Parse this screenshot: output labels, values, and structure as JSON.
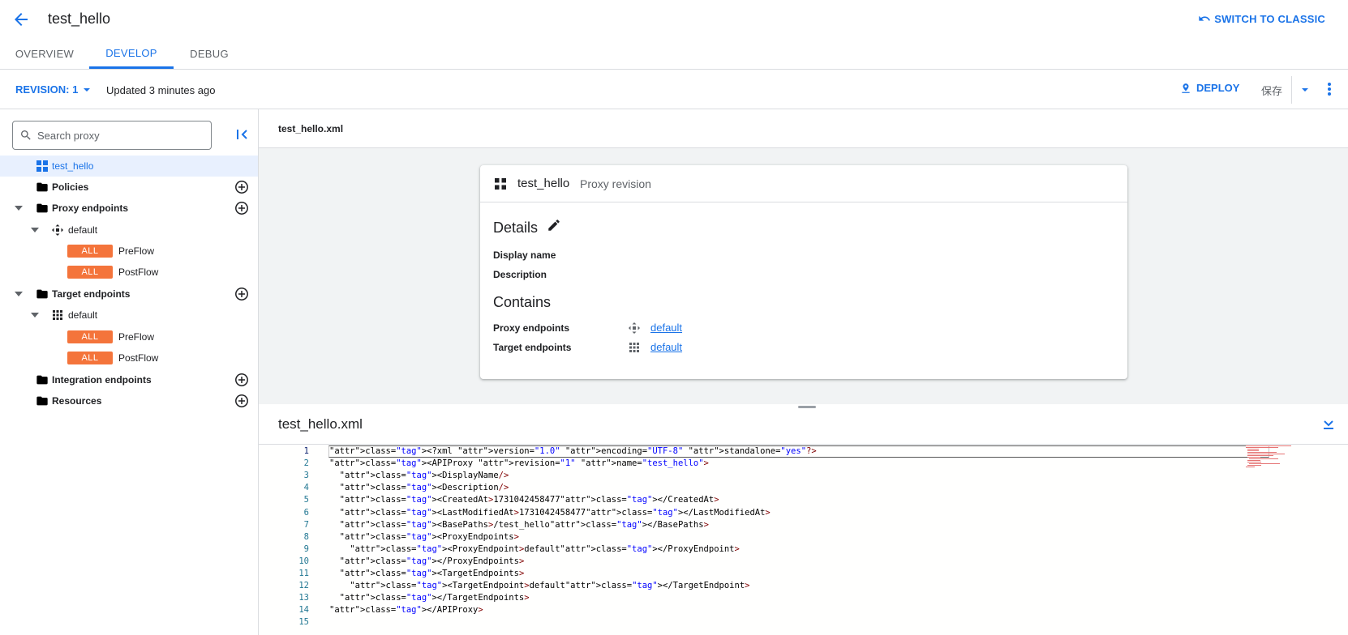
{
  "header": {
    "title": "test_hello",
    "switch_label": "SWITCH TO CLASSIC"
  },
  "tabs": [
    {
      "label": "OVERVIEW",
      "active": false
    },
    {
      "label": "DEVELOP",
      "active": true
    },
    {
      "label": "DEBUG",
      "active": false
    }
  ],
  "revision_bar": {
    "revision_label": "REVISION: 1",
    "updated": "Updated 3 minutes ago",
    "deploy_label": "DEPLOY",
    "save_label": "保存"
  },
  "sidebar": {
    "search_placeholder": "Search proxy",
    "tree": {
      "root": "test_hello",
      "policies": "Policies",
      "proxy_endpoints": "Proxy endpoints",
      "proxy_default": "default",
      "proxy_flows": [
        {
          "badge": "ALL",
          "label": "PreFlow"
        },
        {
          "badge": "ALL",
          "label": "PostFlow"
        }
      ],
      "target_endpoints": "Target endpoints",
      "target_default": "default",
      "target_flows": [
        {
          "badge": "ALL",
          "label": "PreFlow"
        },
        {
          "badge": "ALL",
          "label": "PostFlow"
        }
      ],
      "integration_endpoints": "Integration endpoints",
      "resources": "Resources"
    }
  },
  "main": {
    "file_tab": "test_hello.xml",
    "card": {
      "title": "test_hello",
      "subtitle": "Proxy revision",
      "details_heading": "Details",
      "display_name_label": "Display name",
      "description_label": "Description",
      "contains_heading": "Contains",
      "proxy_endpoints_label": "Proxy endpoints",
      "proxy_endpoint_link": "default",
      "target_endpoints_label": "Target endpoints",
      "target_endpoint_link": "default"
    },
    "editor_title": "test_hello.xml",
    "code_lines": [
      "<?xml version=\"1.0\" encoding=\"UTF-8\" standalone=\"yes\"?>",
      "<APIProxy revision=\"1\" name=\"test_hello\">",
      "  <DisplayName/>",
      "  <Description/>",
      "  <CreatedAt>1731042458477</CreatedAt>",
      "  <LastModifiedAt>1731042458477</LastModifiedAt>",
      "  <BasePaths>/test_hello</BasePaths>",
      "  <ProxyEndpoints>",
      "    <ProxyEndpoint>default</ProxyEndpoint>",
      "  </ProxyEndpoints>",
      "  <TargetEndpoints>",
      "    <TargetEndpoint>default</TargetEndpoint>",
      "  </TargetEndpoints>",
      "</APIProxy>",
      ""
    ]
  },
  "colors": {
    "accent": "#1a73e8",
    "badge": "#f4743b",
    "selected_bg": "#e8f0fe"
  }
}
